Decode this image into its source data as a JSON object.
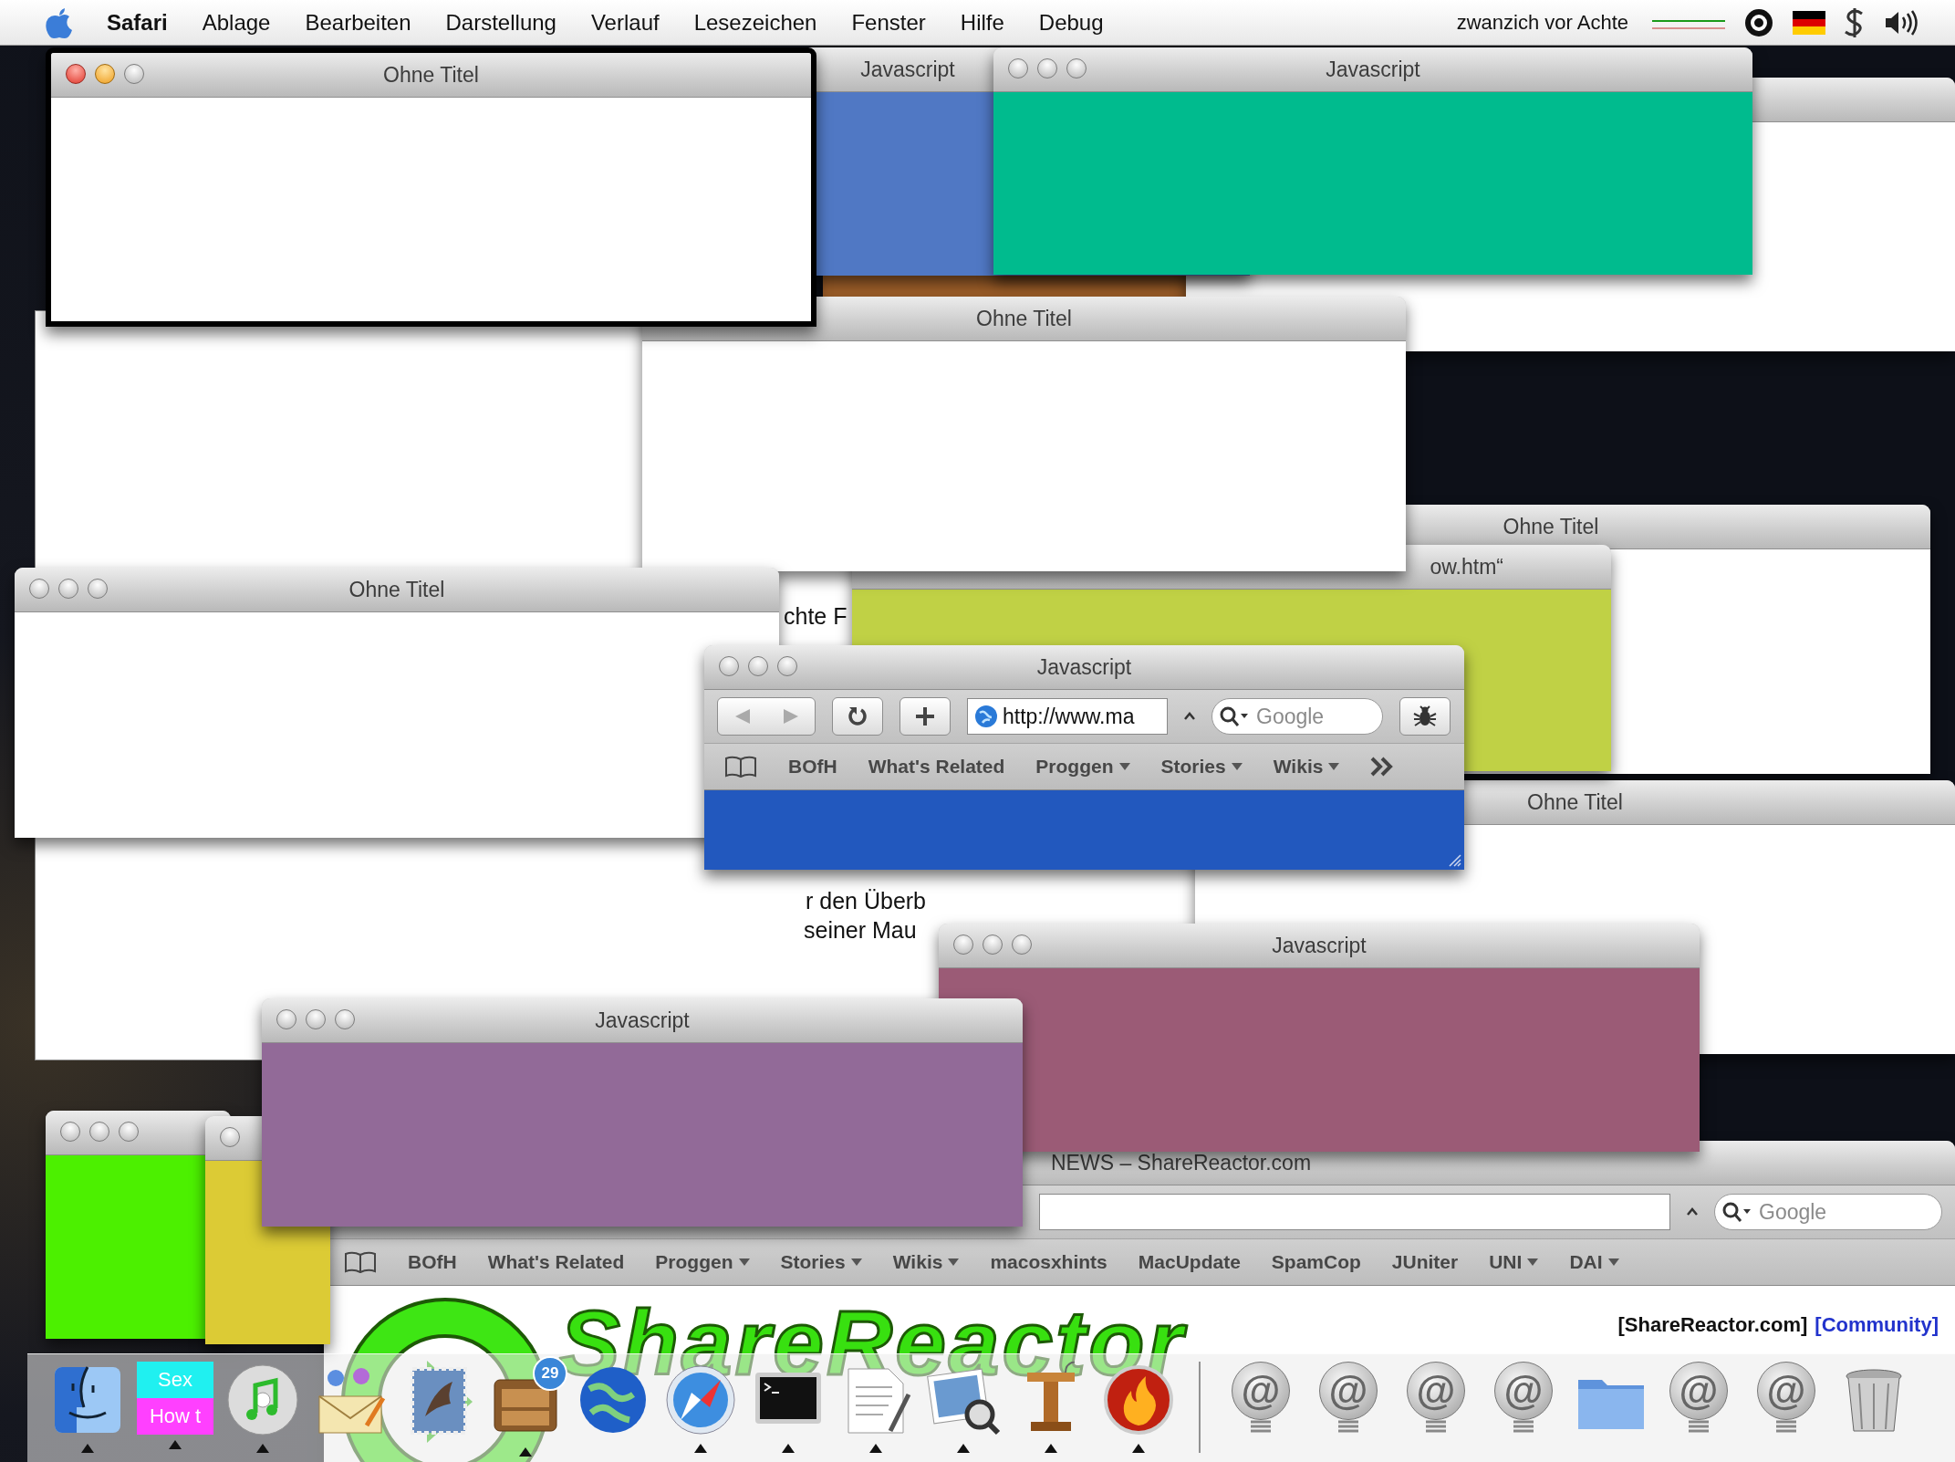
{
  "menu_bar": {
    "items": [
      {
        "label": "Safari",
        "kind": "app"
      },
      {
        "label": "Ablage",
        "kind": "menu"
      },
      {
        "label": "Bearbeiten",
        "kind": "menu"
      },
      {
        "label": "Darstellung",
        "kind": "menu"
      },
      {
        "label": "Verlauf",
        "kind": "menu"
      },
      {
        "label": "Lesezeichen",
        "kind": "menu"
      },
      {
        "label": "Fenster",
        "kind": "menu"
      },
      {
        "label": "Hilfe",
        "kind": "menu"
      },
      {
        "label": "Debug",
        "kind": "menu"
      }
    ],
    "clock": "zwanzich vor Achte"
  },
  "windows": [
    {
      "kind": "page",
      "fragments": [
        "chte F",
        "r den Überb",
        "seiner Mau"
      ]
    },
    {
      "kind": "plain",
      "color": "#a0602a"
    },
    {
      "kind": "plain",
      "color": "#ffffff"
    },
    {
      "kind": "plain",
      "title": "Ohne Titel",
      "color": "#ffffff"
    },
    {
      "kind": "plain",
      "title": "Ohne Titel",
      "color": "#ffffff"
    },
    {
      "kind": "plain",
      "title": "Javascript",
      "color": "#5078c4"
    },
    {
      "kind": "plain",
      "title": "Javascript",
      "color": "#00bb8e",
      "active": false
    },
    {
      "kind": "plain",
      "title": "ow.htm“",
      "color": "#c0d145"
    },
    {
      "kind": "plain",
      "title": "Ohne Titel",
      "color": "#ffffff"
    },
    {
      "kind": "plain",
      "title": "Ohne Titel",
      "color": "#ffffff",
      "active": true
    },
    {
      "kind": "plain",
      "title": "Ohne Titel",
      "color": "#ffffff",
      "active": false
    },
    {
      "kind": "toolbar",
      "title": "Javascript",
      "color": "#2258be",
      "active": false,
      "address": "http://www.ma",
      "search_placeholder": "Google",
      "bookmarks": [
        {
          "label": "BOfH",
          "menu": false
        },
        {
          "label": "What's Related",
          "menu": false
        },
        {
          "label": "Proggen",
          "menu": true
        },
        {
          "label": "Stories",
          "menu": true
        },
        {
          "label": "Wikis",
          "menu": true
        }
      ]
    },
    {
      "kind": "browser",
      "title": "NEWS – ShareReactor.com",
      "search_placeholder": "Google",
      "bookmarks": [
        {
          "label": "BOfH",
          "menu": false
        },
        {
          "label": "What's Related",
          "menu": false
        },
        {
          "label": "Proggen",
          "menu": true
        },
        {
          "label": "Stories",
          "menu": true
        },
        {
          "label": "Wikis",
          "menu": true
        },
        {
          "label": "macosxhints",
          "menu": false
        },
        {
          "label": "MacUpdate",
          "menu": false
        },
        {
          "label": "SpamCop",
          "menu": false
        },
        {
          "label": "JUniter",
          "menu": false
        },
        {
          "label": "UNI",
          "menu": true
        },
        {
          "label": "DAI",
          "menu": true
        }
      ],
      "logo_text": "ShareReactor",
      "links": [
        "[ShareReactor.com]",
        "[Community]"
      ]
    },
    {
      "kind": "plain",
      "title": "Javascript",
      "color": "#9b5b76",
      "active": false
    },
    {
      "kind": "plain",
      "color": "#4cf000",
      "active": false
    },
    {
      "kind": "plain",
      "color": "#dccb35",
      "active": false
    },
    {
      "kind": "plain",
      "title": "Javascript",
      "color": "#926a98",
      "active": false
    }
  ],
  "dock": {
    "items": [
      {
        "kind": "finder",
        "running": true
      },
      {
        "kind": "thumbnail",
        "lines": [
          "Sex",
          "How t"
        ],
        "running": true
      },
      {
        "kind": "disc",
        "running": true
      },
      {
        "kind": "envelope",
        "running": false
      },
      {
        "kind": "stamp",
        "running": false
      },
      {
        "kind": "cabinet",
        "badge": "29",
        "running": true
      },
      {
        "kind": "globe",
        "running": false
      },
      {
        "kind": "compass",
        "running": true
      },
      {
        "kind": "terminal",
        "running": true
      },
      {
        "kind": "document",
        "running": true
      },
      {
        "kind": "photo",
        "running": true
      },
      {
        "kind": "podium",
        "running": true
      },
      {
        "kind": "flame",
        "running": true
      },
      {
        "kind": "divider"
      },
      {
        "kind": "at",
        "glyph": "@",
        "running": false
      },
      {
        "kind": "at",
        "glyph": "@",
        "running": false
      },
      {
        "kind": "at",
        "glyph": "@",
        "running": false
      },
      {
        "kind": "at",
        "glyph": "@",
        "running": false
      },
      {
        "kind": "folder",
        "running": false
      },
      {
        "kind": "at",
        "glyph": "@",
        "running": false
      },
      {
        "kind": "at",
        "glyph": "@",
        "running": false
      },
      {
        "kind": "trash",
        "running": false
      }
    ]
  }
}
